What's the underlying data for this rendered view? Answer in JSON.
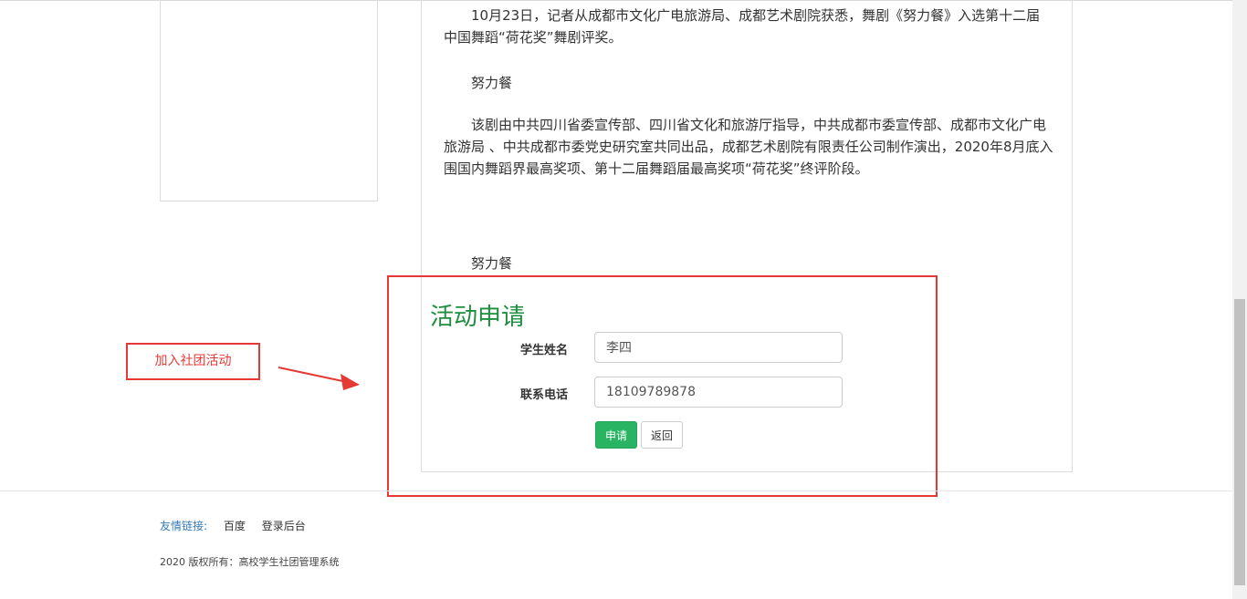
{
  "article": {
    "paragraphs": [
      "10月23日，记者从成都市文化广电旅游局、成都艺术剧院获悉，舞剧《努力餐》入选第十二届中国舞蹈“荷花奖”舞剧评奖。",
      "努力餐",
      "该剧由中共四川省委宣传部、四川省文化和旅游厅指导，中共成都市委宣传部、成都市文化广电旅游局 、中共成都市委党史研究室共同出品，成都艺术剧院有限责任公司制作演出，2020年8月底入围国内舞蹈界最高奖项、第十二届舞蹈届最高奖项“荷花奖”终评阶段。",
      "努力餐"
    ]
  },
  "form": {
    "title": "活动申请",
    "name_label": "学生姓名",
    "name_value": "李四",
    "phone_label": "联系电话",
    "phone_value": "18109789878",
    "submit_label": "申请",
    "back_label": "返回"
  },
  "annotation": {
    "label": "加入社团活动",
    "color": "#e53935"
  },
  "footer": {
    "friend_links_label": "友情链接:",
    "links": [
      "百度",
      "登录后台"
    ],
    "copyright": "2020 版权所有：高校学生社团管理系统"
  },
  "colors": {
    "title_green": "#1e8e3e",
    "submit_green": "#28b463",
    "link_blue": "#337ab7"
  }
}
